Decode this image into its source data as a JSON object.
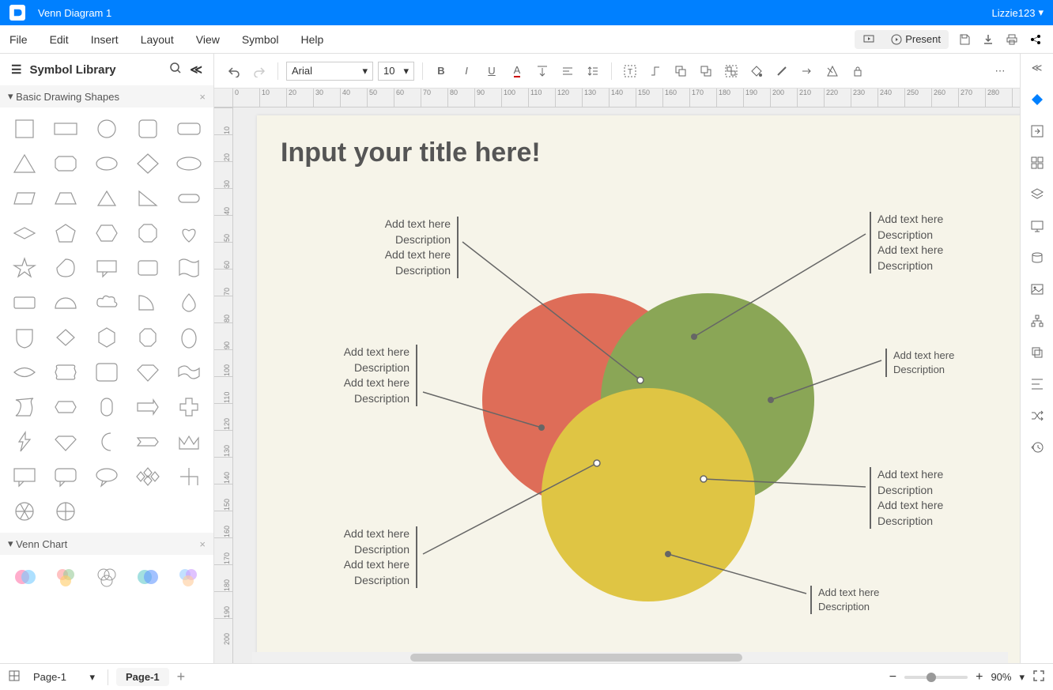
{
  "title_bar": {
    "doc_title": "Venn Diagram 1",
    "user": "Lizzie123"
  },
  "menu": [
    "File",
    "Edit",
    "Insert",
    "Layout",
    "View",
    "Symbol",
    "Help"
  ],
  "menu_right": {
    "present": "Present"
  },
  "library": {
    "title": "Symbol Library",
    "cat1": "Basic Drawing Shapes",
    "cat2": "Venn Chart"
  },
  "toolbar": {
    "font": "Arial",
    "size": "10"
  },
  "canvas": {
    "title": "Input your title here!",
    "callouts": {
      "tl": [
        "Add text here",
        "Description",
        "Add text here",
        "Description"
      ],
      "tr": [
        "Add text here",
        "Description",
        "Add text here",
        "Description"
      ],
      "ml": [
        "Add text here",
        "Description",
        "Add text here",
        "Description"
      ],
      "mr_small": [
        "Add text here",
        "Description"
      ],
      "br": [
        "Add text here",
        "Description",
        "Add text here",
        "Description"
      ],
      "bl": [
        "Add text here",
        "Description",
        "Add text here",
        "Description"
      ],
      "br_small": [
        "Add text here",
        "Description"
      ]
    }
  },
  "ruler_h": [
    0,
    10,
    20,
    30,
    40,
    50,
    60,
    70,
    80,
    90,
    100,
    110,
    120,
    130,
    140,
    150,
    160,
    170,
    180,
    190,
    200,
    210,
    220,
    230,
    240,
    250,
    260,
    270,
    280
  ],
  "ruler_v": [
    10,
    20,
    30,
    40,
    50,
    60,
    70,
    80,
    90,
    100,
    110,
    120,
    130,
    140,
    150,
    160,
    170,
    180,
    190,
    200
  ],
  "status": {
    "page_select": "Page-1",
    "page_tab": "Page-1",
    "zoom": "90%"
  }
}
